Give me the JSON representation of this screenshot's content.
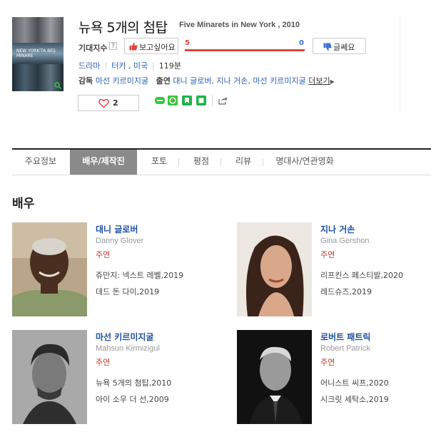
{
  "movie": {
    "title_ko": "뉴욕 5개의 첨탑",
    "title_en": "Five Minarets in New York , 2010",
    "poster_text": "NEW YORK'TA BEŞ MİNARE",
    "expect_label": "기대지수",
    "help_glyph": "?",
    "want_label": "보고싶어요",
    "want_count": "5",
    "notwant_count": "0",
    "notwant_label": "글쎄요",
    "score_fraction": 1.0,
    "genre": "드라마",
    "country": "터키 , 미국",
    "runtime": "119분",
    "director_label": "감독",
    "director": "마선 키르미지굴",
    "cast_label": "출연",
    "cast": "대니 글로버, 지나 거손, 마선 키르미지굴",
    "more_label": "더보기",
    "like_count": "2"
  },
  "tabs": [
    {
      "label": "주요정보",
      "active": false
    },
    {
      "label": "배우/제작진",
      "active": true
    },
    {
      "label": "포토",
      "active": false
    },
    {
      "label": "평점",
      "active": false
    },
    {
      "label": "리뷰",
      "active": false
    },
    {
      "label": "명대사/연관영화",
      "active": false
    }
  ],
  "section_title": "배우",
  "actors": [
    {
      "name_ko": "대니 글로버",
      "name_en": "Danny Glover",
      "role": "주연",
      "works": [
        "쥬만지: 넥스트 레벨,2019",
        "데드 돈 다이,2019"
      ]
    },
    {
      "name_ko": "지나 거손",
      "name_en": "Gina Gershon",
      "role": "주연",
      "works": [
        "리프킨스 페스티발,2020",
        "레드슈즈,2019"
      ]
    },
    {
      "name_ko": "마선 키르미지굴",
      "name_en": "Mahsun Kirmizigul",
      "role": "주연",
      "works": [
        "뉴욕 5개의 첨탑,2010",
        "아이 소우 더 선,2009"
      ]
    },
    {
      "name_ko": "로버트 패트릭",
      "name_en": "Robert Patrick",
      "role": "주연",
      "works": [
        "어니스트 씨프,2020",
        "시크릿 세탁소,2019"
      ]
    }
  ],
  "colors": {
    "accent_red": "#e0463d",
    "accent_blue": "#3d6ed8",
    "link_blue": "#1f4fa0",
    "role_red": "#c0392b",
    "tab_active": "#8a8a8a"
  }
}
